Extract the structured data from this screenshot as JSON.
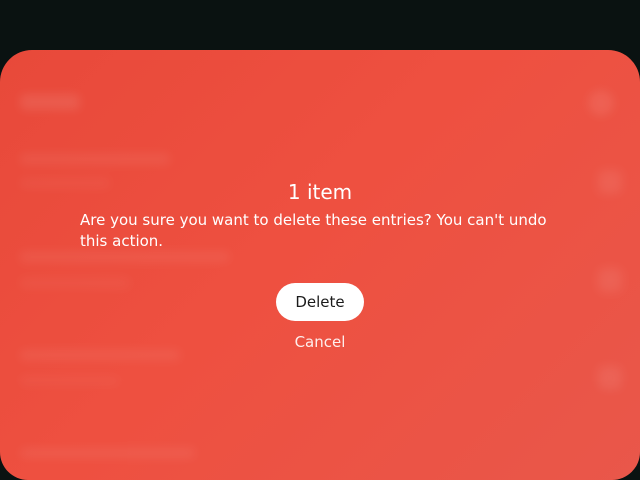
{
  "dialog": {
    "title": "1 item",
    "message": "Are you sure you want to delete these entries? You can't undo this action.",
    "delete_label": "Delete",
    "cancel_label": "Cancel"
  },
  "colors": {
    "sheet_background": "#ee5040",
    "screen_background": "#0a1211",
    "button_background": "#ffffff",
    "button_text": "#1b1b1b"
  }
}
